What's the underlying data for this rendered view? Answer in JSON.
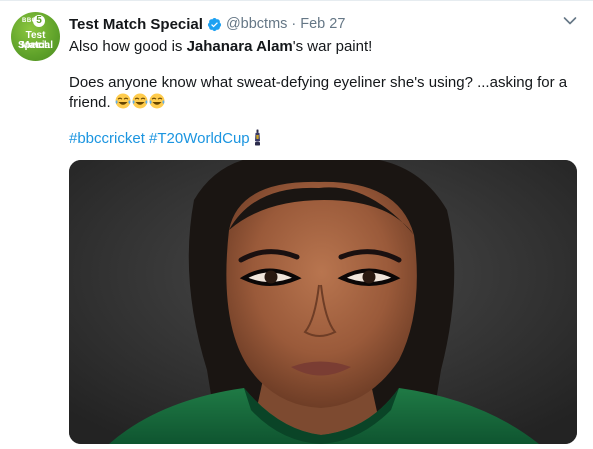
{
  "tweet": {
    "display_name": "Test Match Special",
    "handle": "@bbctms",
    "separator": "·",
    "date": "Feb 27",
    "avatar": {
      "label_top": "BBC",
      "label_num": "5",
      "line1": "Test Match",
      "line2": "Special"
    },
    "text_line1_prefix": "Also how good is ",
    "text_line1_bold": "Jahanara Alam",
    "text_line1_suffix": "'s war paint!",
    "text_line2a": "Does anyone know what sweat-defying eyeliner she's using? ...asking for a",
    "text_line2b": "friend. ",
    "emojis": [
      "face-with-tears-of-joy",
      "face-with-tears-of-joy",
      "face-with-tears-of-joy"
    ],
    "hashtag1": "#bbccricket",
    "hashtag2": "#T20WorldCup",
    "hashtag_emoji": "t20-world-cup-trophy-icon",
    "colors": {
      "link": "#1b95e0",
      "verified": "#1da1f2",
      "muted": "#657786",
      "brand_green": "#5fa22a"
    }
  }
}
